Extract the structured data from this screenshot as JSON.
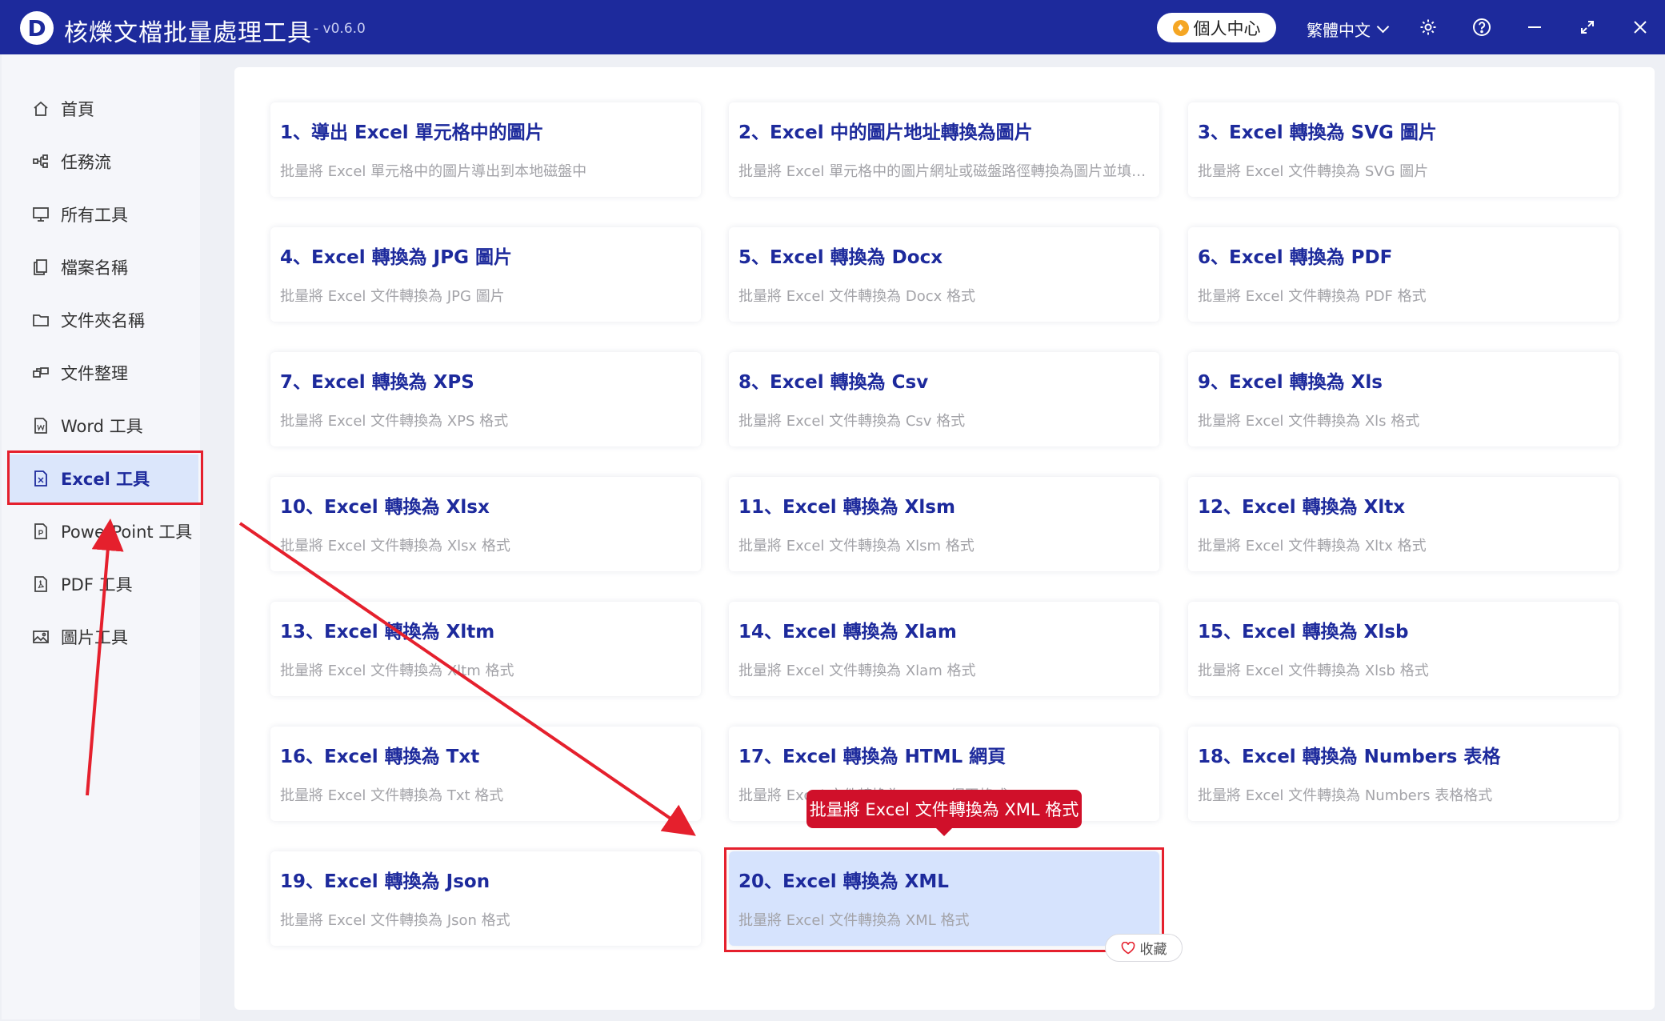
{
  "app": {
    "logo_letter": "D",
    "title": "核爍文檔批量處理工具",
    "version": "- v0.6.0",
    "personal_center": "個人中心",
    "language": "繁體中文"
  },
  "colors": {
    "accent": "#1d2a9c",
    "highlight_red": "#e5202d",
    "selected_card": "#d6e3fd"
  },
  "sidebar": {
    "items": [
      {
        "label": "首頁",
        "icon": "home-icon"
      },
      {
        "label": "任務流",
        "icon": "workflow-icon"
      },
      {
        "label": "所有工具",
        "icon": "monitor-icon"
      },
      {
        "label": "檔案名稱",
        "icon": "file-copy-icon"
      },
      {
        "label": "文件夾名稱",
        "icon": "folder-icon"
      },
      {
        "label": "文件整理",
        "icon": "organize-icon"
      },
      {
        "label": "Word 工具",
        "icon": "word-file-icon"
      },
      {
        "label": "Excel 工具",
        "icon": "excel-file-icon",
        "active": true
      },
      {
        "label": "PowerPoint 工具",
        "icon": "ppt-file-icon"
      },
      {
        "label": "PDF 工具",
        "icon": "pdf-file-icon"
      },
      {
        "label": "圖片工具",
        "icon": "image-icon"
      }
    ]
  },
  "tools": [
    {
      "title": "1、導出 Excel 單元格中的圖片",
      "desc": "批量將 Excel 單元格中的圖片導出到本地磁盤中"
    },
    {
      "title": "2、Excel 中的圖片地址轉換為圖片",
      "desc": "批量將 Excel 單元格中的圖片網址或磁盤路徑轉換為圖片並填充..."
    },
    {
      "title": "3、Excel 轉換為 SVG 圖片",
      "desc": "批量將 Excel 文件轉換為 SVG 圖片"
    },
    {
      "title": "4、Excel 轉換為 JPG 圖片",
      "desc": "批量將 Excel 文件轉換為 JPG 圖片"
    },
    {
      "title": "5、Excel 轉換為 Docx",
      "desc": "批量將 Excel 文件轉換為 Docx 格式"
    },
    {
      "title": "6、Excel 轉換為 PDF",
      "desc": "批量將 Excel 文件轉換為 PDF 格式"
    },
    {
      "title": "7、Excel 轉換為 XPS",
      "desc": "批量將 Excel 文件轉換為 XPS 格式"
    },
    {
      "title": "8、Excel 轉換為 Csv",
      "desc": "批量將 Excel 文件轉換為 Csv 格式"
    },
    {
      "title": "9、Excel 轉換為 Xls",
      "desc": "批量將 Excel 文件轉換為 Xls 格式"
    },
    {
      "title": "10、Excel 轉換為 Xlsx",
      "desc": "批量將 Excel 文件轉換為 Xlsx 格式"
    },
    {
      "title": "11、Excel 轉換為 Xlsm",
      "desc": "批量將 Excel 文件轉換為 Xlsm 格式"
    },
    {
      "title": "12、Excel 轉換為 Xltx",
      "desc": "批量將 Excel 文件轉換為 Xltx 格式"
    },
    {
      "title": "13、Excel 轉換為 Xltm",
      "desc": "批量將 Excel 文件轉換為 Xltm 格式"
    },
    {
      "title": "14、Excel 轉換為 Xlam",
      "desc": "批量將 Excel 文件轉換為 Xlam 格式"
    },
    {
      "title": "15、Excel 轉換為 Xlsb",
      "desc": "批量將 Excel 文件轉換為 Xlsb 格式"
    },
    {
      "title": "16、Excel 轉換為 Txt",
      "desc": "批量將 Excel 文件轉換為 Txt 格式"
    },
    {
      "title": "17、Excel 轉換為 HTML 網頁",
      "desc": "批量將 Excel 文件轉換為 HTML 網頁格式"
    },
    {
      "title": "18、Excel 轉換為 Numbers 表格",
      "desc": "批量將 Excel 文件轉換為 Numbers 表格格式"
    },
    {
      "title": "19、Excel 轉換為 Json",
      "desc": "批量將 Excel 文件轉換為 Json 格式"
    },
    {
      "title": "20、Excel 轉換為 XML",
      "desc": "批量將 Excel 文件轉換為 XML 格式",
      "selected": true
    }
  ],
  "tooltip": "批量將 Excel 文件轉換為 XML 格式",
  "favorite_label": "收藏"
}
